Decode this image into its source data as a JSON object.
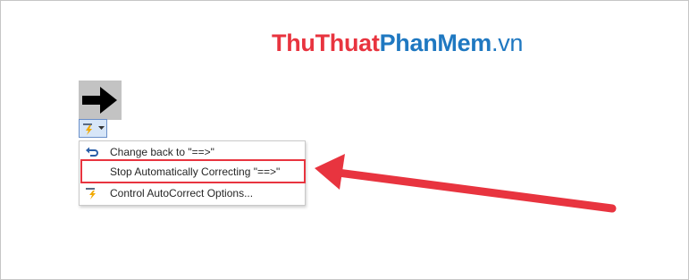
{
  "watermark": {
    "part1": "ThuThuat",
    "part2": "PhanMem",
    "part3": ".vn"
  },
  "autocorrect": {
    "glyph_icon": "right-arrow-symbol",
    "options_button_icon": "lightning-icon",
    "options_chevron_icon": "chevron-down-icon"
  },
  "menu": {
    "items": [
      {
        "label": "Change back to \"==>\"",
        "icon": "undo-icon"
      },
      {
        "label": "Stop Automatically Correcting \"==>\"",
        "icon": ""
      },
      {
        "label": "Control AutoCorrect Options...",
        "icon": "autocorrect-options-icon"
      }
    ]
  },
  "colors": {
    "highlight": "#e8343f",
    "brand_red": "#e8343f",
    "brand_blue": "#1f78c1"
  }
}
